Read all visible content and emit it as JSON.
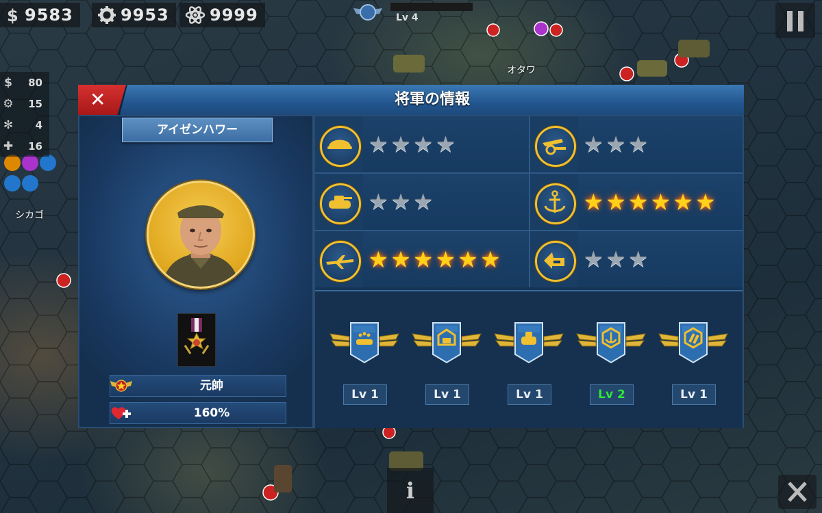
{
  "hud": {
    "money": "9583",
    "gear": "9953",
    "atom": "9999",
    "player_level": "Lv 4"
  },
  "side_stats": [
    {
      "icon": "dollar-icon",
      "value": "80"
    },
    {
      "icon": "gear-icon",
      "value": "15"
    },
    {
      "icon": "atom-icon",
      "value": "4"
    },
    {
      "icon": "plus-icon",
      "value": "16"
    }
  ],
  "map": {
    "labels": {
      "ottawa": "オタワ",
      "chicago": "シカゴ"
    }
  },
  "dialog": {
    "title": "将軍の情報",
    "general": {
      "name": "アイゼンハワー",
      "rank": "元帥",
      "hp_bonus": "160%"
    },
    "skills": [
      {
        "icon": "infantry-helmet-icon",
        "stars": 4,
        "gold": false
      },
      {
        "icon": "artillery-cannon-icon",
        "stars": 3,
        "gold": false
      },
      {
        "icon": "tank-icon",
        "stars": 3,
        "gold": false
      },
      {
        "icon": "anchor-navy-icon",
        "stars": 6,
        "gold": true
      },
      {
        "icon": "airplane-icon",
        "stars": 6,
        "gold": true
      },
      {
        "icon": "logistics-icon",
        "stars": 3,
        "gold": false
      }
    ],
    "badges": [
      {
        "icon": "fleet-badge-icon",
        "level": "Lv 1",
        "highlight": false
      },
      {
        "icon": "fortress-badge-icon",
        "level": "Lv 1",
        "highlight": false
      },
      {
        "icon": "armor-badge-icon",
        "level": "Lv 1",
        "highlight": false
      },
      {
        "icon": "anchor-badge-icon",
        "level": "Lv 2",
        "highlight": true
      },
      {
        "icon": "shells-badge-icon",
        "level": "Lv 1",
        "highlight": false
      }
    ]
  },
  "colors": {
    "accent_blue": "#23568e",
    "close_red": "#c02020",
    "gold": "#ffd21a",
    "level_highlight": "#2ee83a"
  }
}
